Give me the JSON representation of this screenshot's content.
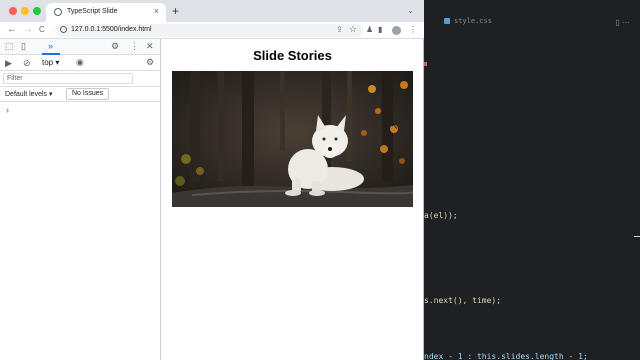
{
  "browser": {
    "tab_title": "TypeScript Slide",
    "tab_close": "×",
    "new_tab": "+",
    "tab_menu": "⌄",
    "url": "127.0.0.1:5500/index.html",
    "nav": {
      "back": "←",
      "forward": "→",
      "reload": "C"
    }
  },
  "devtools": {
    "more_tabs": "»",
    "context": "top ▾",
    "filter_placeholder": "Filter",
    "levels": "Default levels ▾",
    "issues": "No Issues",
    "prompt": "›"
  },
  "page": {
    "title": "Slide Stories"
  },
  "editor": {
    "tab_name": "style.css",
    "lines": [
      {
        "text": "a(el));"
      },
      {
        "text": "s.next(), time);"
      },
      {
        "text": "ndex - 1 : this.slides.length - 1;"
      }
    ]
  }
}
